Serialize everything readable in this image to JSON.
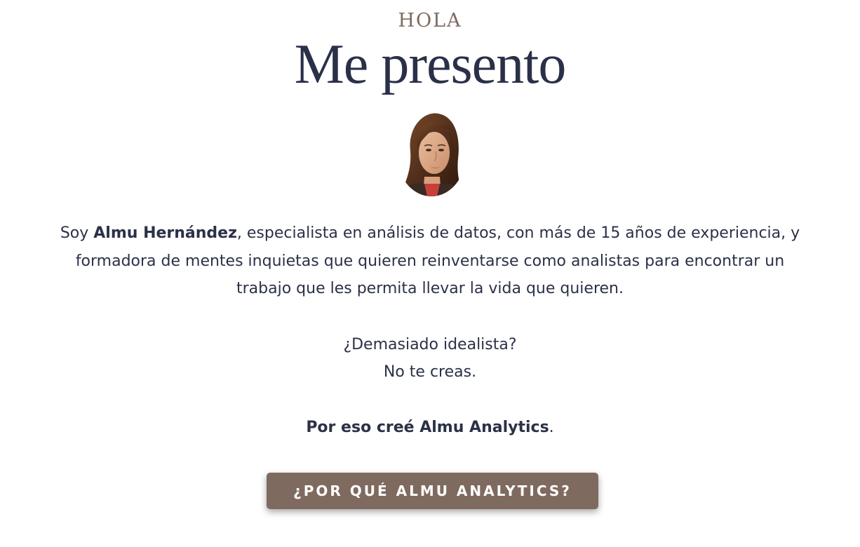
{
  "section": {
    "eyebrow": "HOLA",
    "title": "Me presento"
  },
  "avatar": {
    "icon": "portrait-photo"
  },
  "bio": {
    "prefix": "Soy ",
    "name": "Almu Hernández",
    "rest": ", especialista en análisis de datos, con más de 15 años de experiencia, y formadora de mentes inquietas que quieren reinventarse como analistas para encontrar un trabajo que les permita llevar la vida que quieren."
  },
  "questions": {
    "line1": "¿Demasiado idealista?",
    "line2": "No te creas."
  },
  "closing": {
    "text": "Por eso creé Almu Analytics",
    "period": "."
  },
  "cta": {
    "label": "¿POR QUÉ ALMU ANALYTICS?"
  },
  "colors": {
    "eyebrow": "#7c6a5e",
    "heading": "#2a3048",
    "body_text": "#2b3147",
    "button_bg": "#7f6a5f",
    "button_text": "#ffffff"
  }
}
